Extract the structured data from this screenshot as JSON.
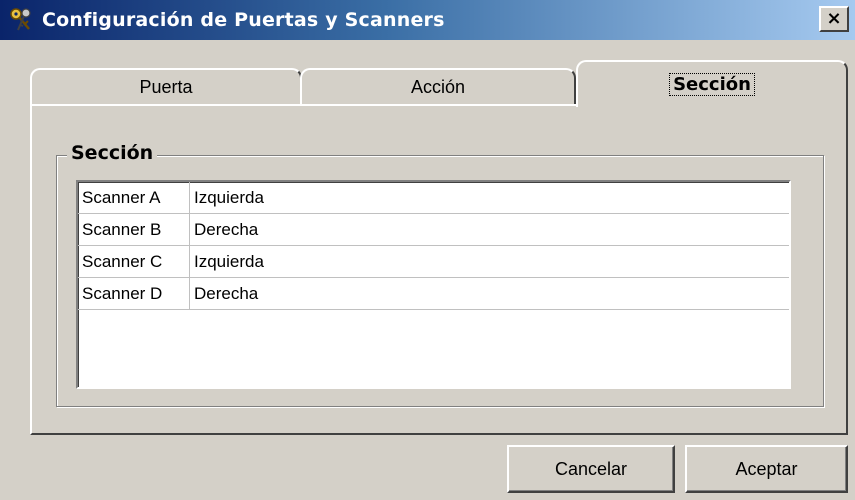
{
  "window": {
    "title": "Configuración de Puertas y Scanners",
    "close_label": "×"
  },
  "tabs": [
    {
      "label": "Puerta",
      "selected": false
    },
    {
      "label": "Acción",
      "selected": false
    },
    {
      "label": "Sección",
      "selected": true
    }
  ],
  "group": {
    "label": "Sección"
  },
  "grid": {
    "rows": [
      {
        "name": "Scanner A",
        "side": "Izquierda"
      },
      {
        "name": "Scanner B",
        "side": "Derecha"
      },
      {
        "name": "Scanner C",
        "side": "Izquierda"
      },
      {
        "name": "Scanner D",
        "side": "Derecha"
      }
    ]
  },
  "buttons": {
    "cancel_label": "Cancelar",
    "ok_label": "Aceptar"
  },
  "colors": {
    "titlebar_start": "#0a246a",
    "titlebar_end": "#a6caf0",
    "face": "#d4d0c8"
  }
}
